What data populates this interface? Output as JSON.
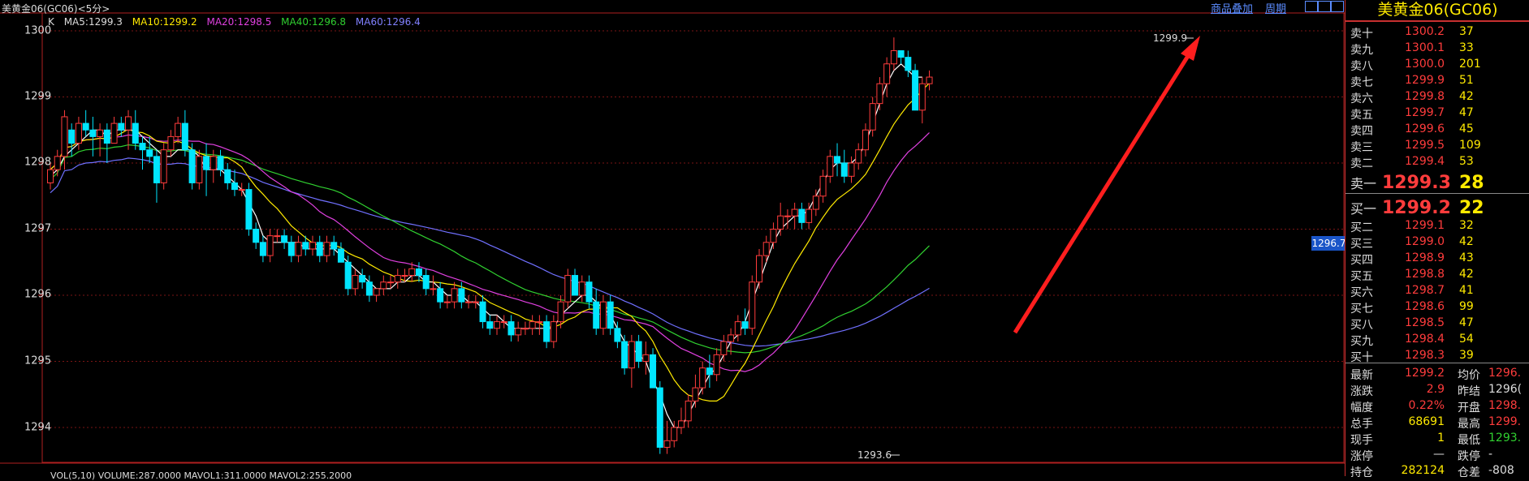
{
  "window": {
    "title": "美黄金06(GC06)<5分>"
  },
  "toolbar": {
    "overlay_label": "商品叠加",
    "period_label": "周期"
  },
  "legend": {
    "k": "K",
    "ma5": "MA5:1299.3",
    "ma10": "MA10:1299.2",
    "ma20": "MA20:1298.5",
    "ma40": "MA40:1296.8",
    "ma60": "MA60:1296.4"
  },
  "colors": {
    "up": "#ff3c3c",
    "down": "#00e5ff",
    "ma5": "#ffffff",
    "ma10": "#ffea00",
    "ma20": "#e040e0",
    "ma40": "#30d030",
    "ma60": "#7070ff",
    "arrow": "#ff1e1e"
  },
  "chart_data": {
    "type": "candlestick",
    "ylim": [
      1293.4,
      1300.35
    ],
    "yticks": [
      "1300",
      "1299",
      "1298",
      "1297",
      "1296",
      "1295",
      "1294"
    ],
    "high_marker": "1299.9",
    "low_marker": "1293.6",
    "last_tag": "1296.7",
    "ohlc": [
      [
        1297.7,
        1298.0,
        1297.6,
        1297.9
      ],
      [
        1297.9,
        1298.2,
        1297.8,
        1298.1
      ],
      [
        1298.1,
        1298.8,
        1297.9,
        1298.7
      ],
      [
        1298.5,
        1298.6,
        1298.1,
        1298.3
      ],
      [
        1298.3,
        1298.7,
        1298.2,
        1298.6
      ],
      [
        1298.6,
        1298.8,
        1298.4,
        1298.5
      ],
      [
        1298.5,
        1298.7,
        1298.1,
        1298.4
      ],
      [
        1298.4,
        1298.6,
        1298.1,
        1298.5
      ],
      [
        1298.5,
        1298.6,
        1298.0,
        1298.3
      ],
      [
        1298.3,
        1298.7,
        1298.3,
        1298.6
      ],
      [
        1298.6,
        1298.7,
        1298.4,
        1298.5
      ],
      [
        1298.5,
        1298.8,
        1298.2,
        1298.7
      ],
      [
        1298.6,
        1298.8,
        1298.2,
        1298.3
      ],
      [
        1298.3,
        1298.4,
        1297.9,
        1298.2
      ],
      [
        1298.2,
        1298.4,
        1298.0,
        1298.1
      ],
      [
        1298.1,
        1298.2,
        1297.4,
        1297.7
      ],
      [
        1297.7,
        1298.3,
        1297.6,
        1298.2
      ],
      [
        1298.2,
        1298.5,
        1298.1,
        1298.4
      ],
      [
        1298.4,
        1298.7,
        1298.3,
        1298.6
      ],
      [
        1298.6,
        1298.8,
        1298.1,
        1298.2
      ],
      [
        1298.2,
        1298.3,
        1297.6,
        1297.7
      ],
      [
        1297.7,
        1298.2,
        1297.6,
        1298.1
      ],
      [
        1298.1,
        1298.3,
        1297.5,
        1297.9
      ],
      [
        1297.9,
        1298.2,
        1297.7,
        1298.1
      ],
      [
        1298.1,
        1298.2,
        1297.8,
        1297.9
      ],
      [
        1297.9,
        1298.0,
        1297.6,
        1297.7
      ],
      [
        1297.7,
        1297.9,
        1297.5,
        1297.6
      ],
      [
        1297.6,
        1297.7,
        1297.5,
        1297.6
      ],
      [
        1297.6,
        1297.7,
        1296.9,
        1297.0
      ],
      [
        1297.0,
        1297.1,
        1296.7,
        1296.8
      ],
      [
        1296.8,
        1296.9,
        1296.5,
        1296.6
      ],
      [
        1296.6,
        1297.0,
        1296.5,
        1296.9
      ],
      [
        1296.9,
        1297.0,
        1296.8,
        1296.9
      ],
      [
        1296.9,
        1297.0,
        1296.7,
        1296.8
      ],
      [
        1296.8,
        1296.9,
        1296.5,
        1296.6
      ],
      [
        1296.6,
        1296.9,
        1296.5,
        1296.8
      ],
      [
        1296.8,
        1296.9,
        1296.6,
        1296.7
      ],
      [
        1296.7,
        1296.9,
        1296.6,
        1296.8
      ],
      [
        1296.8,
        1296.9,
        1296.5,
        1296.6
      ],
      [
        1296.6,
        1296.9,
        1296.5,
        1296.8
      ],
      [
        1296.8,
        1296.9,
        1296.6,
        1296.7
      ],
      [
        1296.7,
        1296.8,
        1296.5,
        1296.5
      ],
      [
        1296.5,
        1296.6,
        1296.0,
        1296.1
      ],
      [
        1296.1,
        1296.4,
        1296.0,
        1296.3
      ],
      [
        1296.3,
        1296.4,
        1296.1,
        1296.2
      ],
      [
        1296.2,
        1296.3,
        1295.9,
        1296.0
      ],
      [
        1296.0,
        1296.1,
        1295.9,
        1296.1
      ],
      [
        1296.1,
        1296.3,
        1296.0,
        1296.2
      ],
      [
        1296.2,
        1296.3,
        1296.1,
        1296.2
      ],
      [
        1296.2,
        1296.4,
        1296.1,
        1296.3
      ],
      [
        1296.3,
        1296.4,
        1296.2,
        1296.3
      ],
      [
        1296.3,
        1296.5,
        1296.2,
        1296.4
      ],
      [
        1296.4,
        1296.5,
        1296.2,
        1296.3
      ],
      [
        1296.3,
        1296.4,
        1296.0,
        1296.1
      ],
      [
        1296.1,
        1296.3,
        1296.0,
        1296.1
      ],
      [
        1296.1,
        1296.2,
        1295.8,
        1295.9
      ],
      [
        1295.9,
        1296.0,
        1295.8,
        1295.9
      ],
      [
        1295.9,
        1296.2,
        1295.8,
        1296.1
      ],
      [
        1296.1,
        1296.2,
        1295.8,
        1295.9
      ],
      [
        1295.9,
        1296.0,
        1295.8,
        1295.9
      ],
      [
        1295.9,
        1296.0,
        1295.8,
        1295.9
      ],
      [
        1295.9,
        1296.0,
        1295.5,
        1295.6
      ],
      [
        1295.6,
        1295.7,
        1295.4,
        1295.5
      ],
      [
        1295.5,
        1295.7,
        1295.4,
        1295.6
      ],
      [
        1295.6,
        1295.7,
        1295.5,
        1295.6
      ],
      [
        1295.6,
        1295.7,
        1295.3,
        1295.4
      ],
      [
        1295.4,
        1295.6,
        1295.3,
        1295.5
      ],
      [
        1295.5,
        1295.6,
        1295.4,
        1295.5
      ],
      [
        1295.5,
        1295.7,
        1295.4,
        1295.6
      ],
      [
        1295.6,
        1295.7,
        1295.4,
        1295.6
      ],
      [
        1295.6,
        1295.7,
        1295.2,
        1295.3
      ],
      [
        1295.3,
        1295.7,
        1295.2,
        1295.6
      ],
      [
        1295.6,
        1296.0,
        1295.5,
        1295.9
      ],
      [
        1295.9,
        1296.4,
        1295.8,
        1296.3
      ],
      [
        1296.3,
        1296.4,
        1296.0,
        1296.0
      ],
      [
        1296.0,
        1296.3,
        1295.9,
        1296.2
      ],
      [
        1296.2,
        1296.3,
        1295.8,
        1295.9
      ],
      [
        1295.9,
        1296.1,
        1295.4,
        1295.5
      ],
      [
        1295.5,
        1296.0,
        1295.4,
        1295.9
      ],
      [
        1295.9,
        1296.0,
        1295.4,
        1295.5
      ],
      [
        1295.5,
        1295.6,
        1295.2,
        1295.3
      ],
      [
        1295.3,
        1295.4,
        1294.8,
        1294.9
      ],
      [
        1294.9,
        1295.4,
        1294.6,
        1295.3
      ],
      [
        1295.3,
        1295.4,
        1294.9,
        1295.0
      ],
      [
        1295.0,
        1295.3,
        1294.8,
        1295.1
      ],
      [
        1295.1,
        1295.2,
        1294.6,
        1294.6
      ],
      [
        1294.6,
        1294.7,
        1293.6,
        1293.7
      ],
      [
        1293.7,
        1294.1,
        1293.6,
        1293.8
      ],
      [
        1293.8,
        1294.1,
        1293.7,
        1294.0
      ],
      [
        1294.0,
        1294.3,
        1293.9,
        1294.1
      ],
      [
        1294.1,
        1294.5,
        1294.0,
        1294.4
      ],
      [
        1294.4,
        1294.8,
        1294.3,
        1294.6
      ],
      [
        1294.6,
        1295.0,
        1294.5,
        1294.9
      ],
      [
        1294.9,
        1295.1,
        1294.6,
        1294.8
      ],
      [
        1294.8,
        1295.2,
        1294.7,
        1295.1
      ],
      [
        1295.1,
        1295.4,
        1295.0,
        1295.3
      ],
      [
        1295.3,
        1295.5,
        1295.1,
        1295.4
      ],
      [
        1295.4,
        1295.7,
        1295.3,
        1295.6
      ],
      [
        1295.6,
        1295.8,
        1295.4,
        1295.5
      ],
      [
        1295.5,
        1296.3,
        1295.4,
        1296.2
      ],
      [
        1296.2,
        1296.7,
        1296.1,
        1296.6
      ],
      [
        1296.6,
        1296.9,
        1296.5,
        1296.8
      ],
      [
        1296.8,
        1297.1,
        1296.7,
        1297.0
      ],
      [
        1297.0,
        1297.4,
        1296.9,
        1297.2
      ],
      [
        1297.2,
        1297.3,
        1297.0,
        1297.2
      ],
      [
        1297.2,
        1297.4,
        1297.0,
        1297.3
      ],
      [
        1297.3,
        1297.4,
        1297.0,
        1297.1
      ],
      [
        1297.1,
        1297.4,
        1297.0,
        1297.3
      ],
      [
        1297.3,
        1297.6,
        1297.2,
        1297.5
      ],
      [
        1297.5,
        1297.9,
        1297.4,
        1297.8
      ],
      [
        1297.8,
        1298.2,
        1297.7,
        1298.1
      ],
      [
        1298.1,
        1298.3,
        1297.8,
        1298.0
      ],
      [
        1298.0,
        1298.2,
        1297.7,
        1297.8
      ],
      [
        1297.8,
        1298.1,
        1297.7,
        1298.0
      ],
      [
        1298.0,
        1298.3,
        1297.9,
        1298.2
      ],
      [
        1298.2,
        1298.6,
        1298.1,
        1298.5
      ],
      [
        1298.5,
        1299.0,
        1298.4,
        1298.9
      ],
      [
        1298.9,
        1299.3,
        1298.8,
        1299.2
      ],
      [
        1299.2,
        1299.6,
        1299.0,
        1299.5
      ],
      [
        1299.5,
        1299.9,
        1299.4,
        1299.7
      ],
      [
        1299.7,
        1299.7,
        1299.5,
        1299.6
      ],
      [
        1299.6,
        1299.7,
        1299.3,
        1299.4
      ],
      [
        1299.4,
        1299.5,
        1298.8,
        1298.8
      ],
      [
        1298.8,
        1299.3,
        1298.6,
        1299.2
      ],
      [
        1299.2,
        1299.4,
        1299.1,
        1299.3
      ]
    ],
    "ma5": [
      1297.8,
      1297.9,
      1298.1,
      1298.2,
      1298.3,
      1298.4,
      1298.5,
      1298.5,
      1298.4,
      1298.5,
      1298.5,
      1298.5,
      1298.5,
      1298.4,
      1298.3,
      1298.2,
      1298.1,
      1298.1,
      1298.2,
      1298.2,
      1298.2,
      1298.1,
      1297.9,
      1297.9,
      1297.9,
      1297.8,
      1297.7,
      1297.6,
      1297.4,
      1297.2,
      1296.9,
      1296.8,
      1296.8,
      1296.8,
      1296.8,
      1296.8,
      1296.7,
      1296.7,
      1296.7,
      1296.7,
      1296.7,
      1296.6,
      1296.5,
      1296.4,
      1296.3,
      1296.2,
      1296.1,
      1296.1,
      1296.1,
      1296.2,
      1296.2,
      1296.3,
      1296.3,
      1296.2,
      1296.2,
      1296.1,
      1296.0,
      1296.0,
      1296.0,
      1295.9,
      1295.9,
      1295.8,
      1295.7,
      1295.7,
      1295.6,
      1295.5,
      1295.5,
      1295.5,
      1295.5,
      1295.5,
      1295.5,
      1295.5,
      1295.7,
      1295.8,
      1295.9,
      1296.0,
      1296.0,
      1295.9,
      1295.8,
      1295.7,
      1295.5,
      1295.3,
      1295.2,
      1295.1,
      1295.0,
      1294.7,
      1294.5,
      1294.2,
      1294.0,
      1294.0,
      1294.2,
      1294.4,
      1294.6,
      1294.8,
      1294.9,
      1295.1,
      1295.3,
      1295.4,
      1295.6,
      1295.9,
      1296.2,
      1296.5,
      1296.8,
      1297.0,
      1297.1,
      1297.2,
      1297.2,
      1297.3,
      1297.5,
      1297.7,
      1297.9,
      1298.0,
      1298.0,
      1298.0,
      1298.1,
      1298.3,
      1298.6,
      1298.9,
      1299.2,
      1299.4,
      1299.5,
      1299.4,
      1299.3,
      1299.3
    ]
  },
  "quote": {
    "title": "美黄金06(GC06)",
    "asks": [
      {
        "label": "卖十",
        "price": "1300.2",
        "vol": "37"
      },
      {
        "label": "卖九",
        "price": "1300.1",
        "vol": "33"
      },
      {
        "label": "卖八",
        "price": "1300.0",
        "vol": "201"
      },
      {
        "label": "卖七",
        "price": "1299.9",
        "vol": "51"
      },
      {
        "label": "卖六",
        "price": "1299.8",
        "vol": "42"
      },
      {
        "label": "卖五",
        "price": "1299.7",
        "vol": "47"
      },
      {
        "label": "卖四",
        "price": "1299.6",
        "vol": "45"
      },
      {
        "label": "卖三",
        "price": "1299.5",
        "vol": "109"
      },
      {
        "label": "卖二",
        "price": "1299.4",
        "vol": "53"
      },
      {
        "label": "卖一",
        "price": "1299.3",
        "vol": "28"
      }
    ],
    "bids": [
      {
        "label": "买一",
        "price": "1299.2",
        "vol": "22"
      },
      {
        "label": "买二",
        "price": "1299.1",
        "vol": "32"
      },
      {
        "label": "买三",
        "price": "1299.0",
        "vol": "42"
      },
      {
        "label": "买四",
        "price": "1298.9",
        "vol": "43"
      },
      {
        "label": "买五",
        "price": "1298.8",
        "vol": "42"
      },
      {
        "label": "买六",
        "price": "1298.7",
        "vol": "41"
      },
      {
        "label": "买七",
        "price": "1298.6",
        "vol": "99"
      },
      {
        "label": "买八",
        "price": "1298.5",
        "vol": "47"
      },
      {
        "label": "买九",
        "price": "1298.4",
        "vol": "54"
      },
      {
        "label": "买十",
        "price": "1298.3",
        "vol": "39"
      }
    ],
    "stats": [
      {
        "l1": "最新",
        "v1": "1299.2",
        "c1": "red",
        "l2": "均价",
        "v2": "1296.",
        "c2": "red"
      },
      {
        "l1": "涨跌",
        "v1": "2.9",
        "c1": "red",
        "l2": "昨结",
        "v2": "1296(",
        "c2": "wht"
      },
      {
        "l1": "幅度",
        "v1": "0.22%",
        "c1": "red",
        "l2": "开盘",
        "v2": "1298.",
        "c2": "red"
      },
      {
        "l1": "总手",
        "v1": "68691",
        "c1": "yel",
        "l2": "最高",
        "v2": "1299.",
        "c2": "red"
      },
      {
        "l1": "现手",
        "v1": "1",
        "c1": "yel",
        "l2": "最低",
        "v2": "1293.",
        "c2": "grn"
      },
      {
        "l1": "涨停",
        "v1": "—",
        "c1": "wht",
        "l2": "跌停",
        "v2": "-",
        "c2": "wht"
      },
      {
        "l1": "持仓",
        "v1": "282124",
        "c1": "yel",
        "l2": "仓差",
        "v2": "-808",
        "c2": "wht"
      }
    ]
  },
  "volume_legend": "VOL(5,10) VOLUME:287.0000 MAVOL1:311.0000 MAVOL2:255.2000"
}
